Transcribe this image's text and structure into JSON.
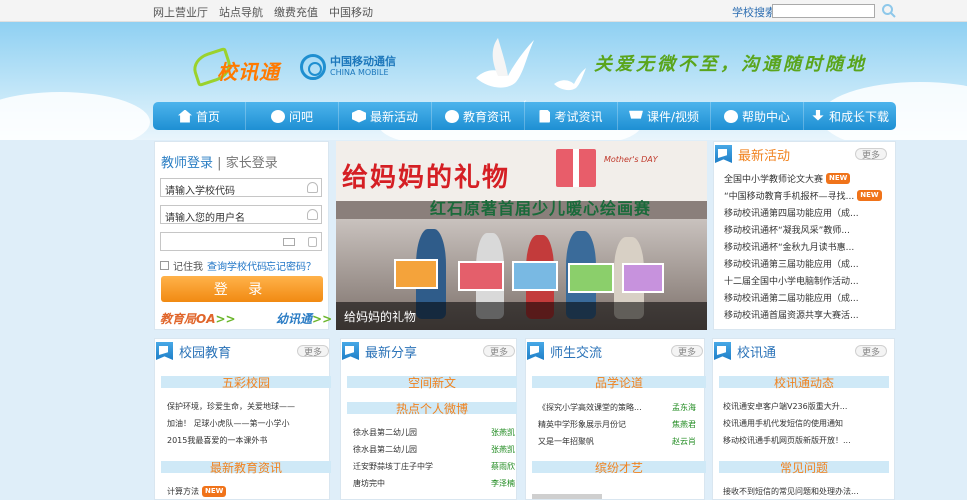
{
  "topbar": {
    "links": [
      "网上营业厅",
      "站点导航",
      "缴费充值",
      "中国移动"
    ],
    "search_label": "学校搜索：",
    "search_placeholder": ""
  },
  "header": {
    "logo_text": "校讯通",
    "cmcc_cn": "中国移动通信",
    "cmcc_en": "CHINA MOBILE",
    "slogan": "关爱无微不至，沟通随时随地"
  },
  "nav": [
    {
      "label": "首页",
      "icon": "home-icon"
    },
    {
      "label": "问吧",
      "icon": "chat-icon"
    },
    {
      "label": "最新活动",
      "icon": "box-icon"
    },
    {
      "label": "教育资讯",
      "icon": "globe-icon"
    },
    {
      "label": "考试资讯",
      "icon": "document-icon"
    },
    {
      "label": "课件/视频",
      "icon": "cart-icon"
    },
    {
      "label": "帮助中心",
      "icon": "help-icon"
    },
    {
      "label": "和成长下载",
      "icon": "download-icon"
    }
  ],
  "login": {
    "tab_teacher": "教师登录",
    "separator": "|",
    "tab_parent": "家长登录",
    "school_code_placeholder": "请输入学校代码",
    "username_placeholder": "请输入您的用户名",
    "remember": "记住我",
    "query_code": "查询学校代码",
    "forgot": "忘记密码？",
    "submit": "登 录",
    "oa_link": "教育局OA",
    "oa_arrow": ">>",
    "yxt_link": "幼讯通",
    "yxt_arrow": ">>"
  },
  "banner": {
    "title": "给妈妈的礼物",
    "subtitle": "红石原著首届少儿暖心绘画赛",
    "caption": "给妈妈的礼物",
    "day_text": "Mother's DAY"
  },
  "news": {
    "title": "最新活动",
    "more": "更多",
    "badge": "NEW",
    "items": [
      {
        "text": "全国中小学教师论文大赛",
        "new": true
      },
      {
        "text": "“中国移动教育手机报杯—寻找...",
        "new": true
      },
      {
        "text": "移动校讯通第四届功能应用（成...",
        "new": false
      },
      {
        "text": "移动校讯通杯“凝我风采”教师...",
        "new": false
      },
      {
        "text": "移动校讯通杯“金秋九月读书惠...",
        "new": false
      },
      {
        "text": "移动校讯通第三届功能应用（成...",
        "new": false
      },
      {
        "text": "十二届全国中小学电脑制作活动...",
        "new": false
      },
      {
        "text": "移动校讯通第二届功能应用（成...",
        "new": false
      },
      {
        "text": "移动校讯通首届资源共享大赛活...",
        "new": false
      }
    ]
  },
  "panels": {
    "p1": {
      "title": "校园教育",
      "more": "更多",
      "sub1": "五彩校园",
      "items1": [
        "保护环境，珍爱生命，关爱地球——",
        "加油！ 足球小虎队——第一小学小",
        "2015我最喜爱的一本课外书"
      ],
      "sub2": "最新教育资讯",
      "items2": [
        {
          "text": "计算方法",
          "new": true
        }
      ]
    },
    "p2": {
      "title": "最新分享",
      "more": "更多",
      "sub1": "空间新文",
      "sub2": "热点个人微博",
      "rows": [
        {
          "text": "徐水县第二幼儿园",
          "author": "张燕凯"
        },
        {
          "text": "徐水县第二幼儿园",
          "author": "张燕凯"
        },
        {
          "text": "迁安野蒜垓丁庄子中学",
          "author": "蔡雨欣"
        },
        {
          "text": "唐坊完中",
          "author": "李泽楠"
        }
      ]
    },
    "p3": {
      "title": "师生交流",
      "more": "更多",
      "sub1": "品学论道",
      "rows": [
        {
          "text": "《探究小学高效课堂的策略...",
          "author": "孟东海"
        },
        {
          "text": "精英中学形象展示月份记",
          "author": "焦燕君"
        },
        {
          "text": "又是一年招聚帆",
          "author": "赵云肖"
        }
      ],
      "sub2": "缤纷才艺"
    },
    "p4": {
      "title": "校讯通",
      "more": "更多",
      "sub1": "校讯通动态",
      "items1": [
        "校讯通安卓客户端V236版重大升...",
        "校讯通用手机代发短信的使用通知",
        "移动校讯通手机网页版新版开放！..."
      ],
      "sub2": "常见问题",
      "items2": [
        "接收不到短信的常见问题和处理办法..."
      ]
    }
  }
}
